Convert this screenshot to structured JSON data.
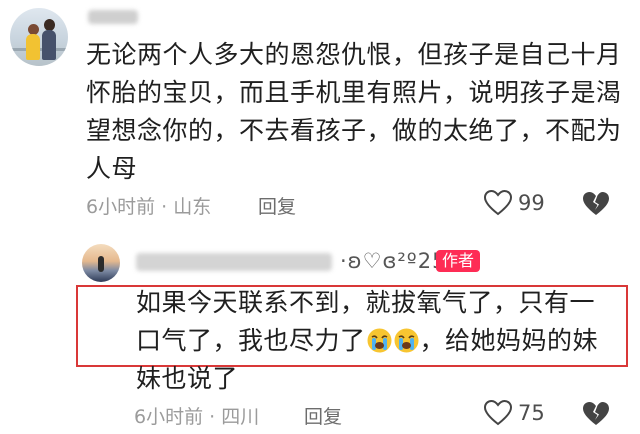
{
  "comment1": {
    "text": "无论两个人多大的恩怨仇恨，但孩子是自己十月怀胎的宝贝，而且手机里有照片，说明孩子是渴望想念你的，不去看孩子，做的太绝了，不配为人母",
    "meta": "6小时前 · 山东",
    "reply_label": "回复",
    "like_count": "99"
  },
  "comment2": {
    "sticker_text": "·ʚ♡ɞ²º25º",
    "author_badge": "作者",
    "text_part1": "如果今天联系不到，就拔氧气了，只有一口气了，我也尽力了",
    "text_part2": "，给她妈妈的妹妹也说了",
    "emoji": [
      "crying-face",
      "crying-face"
    ],
    "meta": "6小时前 · 四川",
    "reply_label": "回复",
    "like_count": "75"
  },
  "colors": {
    "highlight_border": "#d93838",
    "author_badge": "#fe2c55",
    "meta_text": "#9b9b9b"
  }
}
